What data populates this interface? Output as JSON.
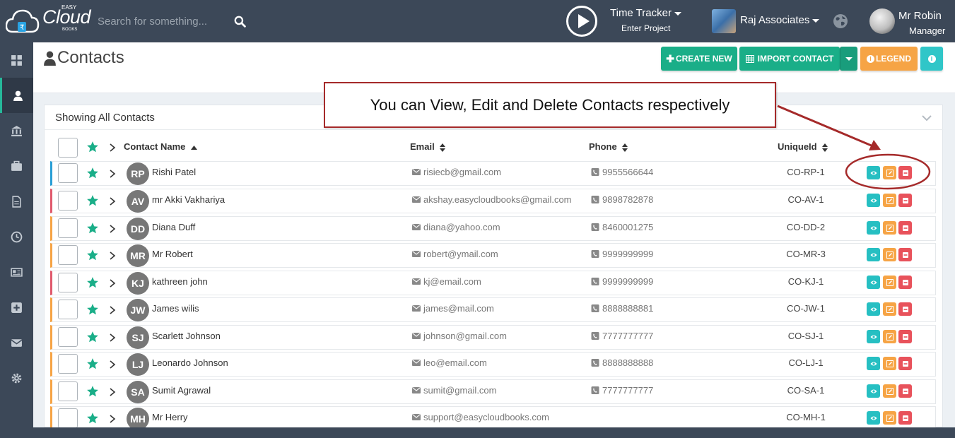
{
  "app": {
    "logo_text": "Cloud",
    "logo_easy": "EASY",
    "logo_books": "BOOKS"
  },
  "search": {
    "placeholder": "Search for something..."
  },
  "time_tracker": {
    "title": "Time Tracker",
    "subtitle": "Enter Project"
  },
  "company": {
    "name": "Raj Associates"
  },
  "user": {
    "name": "Mr Robin",
    "role": "Manager"
  },
  "page": {
    "title": "Contacts"
  },
  "toolbar": {
    "create_label": "CREATE NEW",
    "import_label": "IMPORT CONTACT",
    "legend_label": "LEGEND"
  },
  "panel": {
    "title": "Showing All Contacts"
  },
  "columns": {
    "name": "Contact Name",
    "email": "Email",
    "phone": "Phone",
    "uid": "UniqueId"
  },
  "annotation": {
    "text": "You can View, Edit and Delete Contacts respectively"
  },
  "colors": {
    "accent": "#1aae88",
    "topbar": "#3c4858",
    "view": "#26bfc2",
    "edit": "#f6a445",
    "delete": "#e8525b",
    "annotation": "#a52a2a"
  },
  "contacts": [
    {
      "initials": "RP",
      "name": "Rishi Patel",
      "email": "risiecb@gmail.com",
      "phone": "9955566644",
      "uid": "CO-RP-1",
      "color": "#2a9fd6"
    },
    {
      "initials": "AV",
      "name": "mr Akki Vakhariya",
      "email": "akshay.easycloudbooks@gmail.com",
      "phone": "9898782878",
      "uid": "CO-AV-1",
      "color": "#e05a6d"
    },
    {
      "initials": "DD",
      "name": "Diana Duff",
      "email": "diana@yahoo.com",
      "phone": "8460001275",
      "uid": "CO-DD-2",
      "color": "#f6a445"
    },
    {
      "initials": "MR",
      "name": "Mr Robert",
      "email": "robert@ymail.com",
      "phone": "9999999999",
      "uid": "CO-MR-3",
      "color": "#f6a445"
    },
    {
      "initials": "KJ",
      "name": "kathreen john",
      "email": "kj@email.com",
      "phone": "9999999999",
      "uid": "CO-KJ-1",
      "color": "#e05a6d"
    },
    {
      "initials": "JW",
      "name": "James wilis",
      "email": "james@mail.com",
      "phone": "8888888881",
      "uid": "CO-JW-1",
      "color": "#f6a445"
    },
    {
      "initials": "SJ",
      "name": "Scarlett Johnson",
      "email": "johnson@gmail.com",
      "phone": "7777777777",
      "uid": "CO-SJ-1",
      "color": "#f6a445"
    },
    {
      "initials": "LJ",
      "name": "Leonardo Johnson",
      "email": "leo@email.com",
      "phone": "8888888888",
      "uid": "CO-LJ-1",
      "color": "#f6a445"
    },
    {
      "initials": "SA",
      "name": "Sumit Agrawal",
      "email": "sumit@gmail.com",
      "phone": "7777777777",
      "uid": "CO-SA-1",
      "color": "#f6a445"
    },
    {
      "initials": "MH",
      "name": "Mr Herry",
      "email": "support@easycloudbooks.com",
      "phone": "",
      "uid": "CO-MH-1",
      "color": "#f6a445"
    }
  ]
}
